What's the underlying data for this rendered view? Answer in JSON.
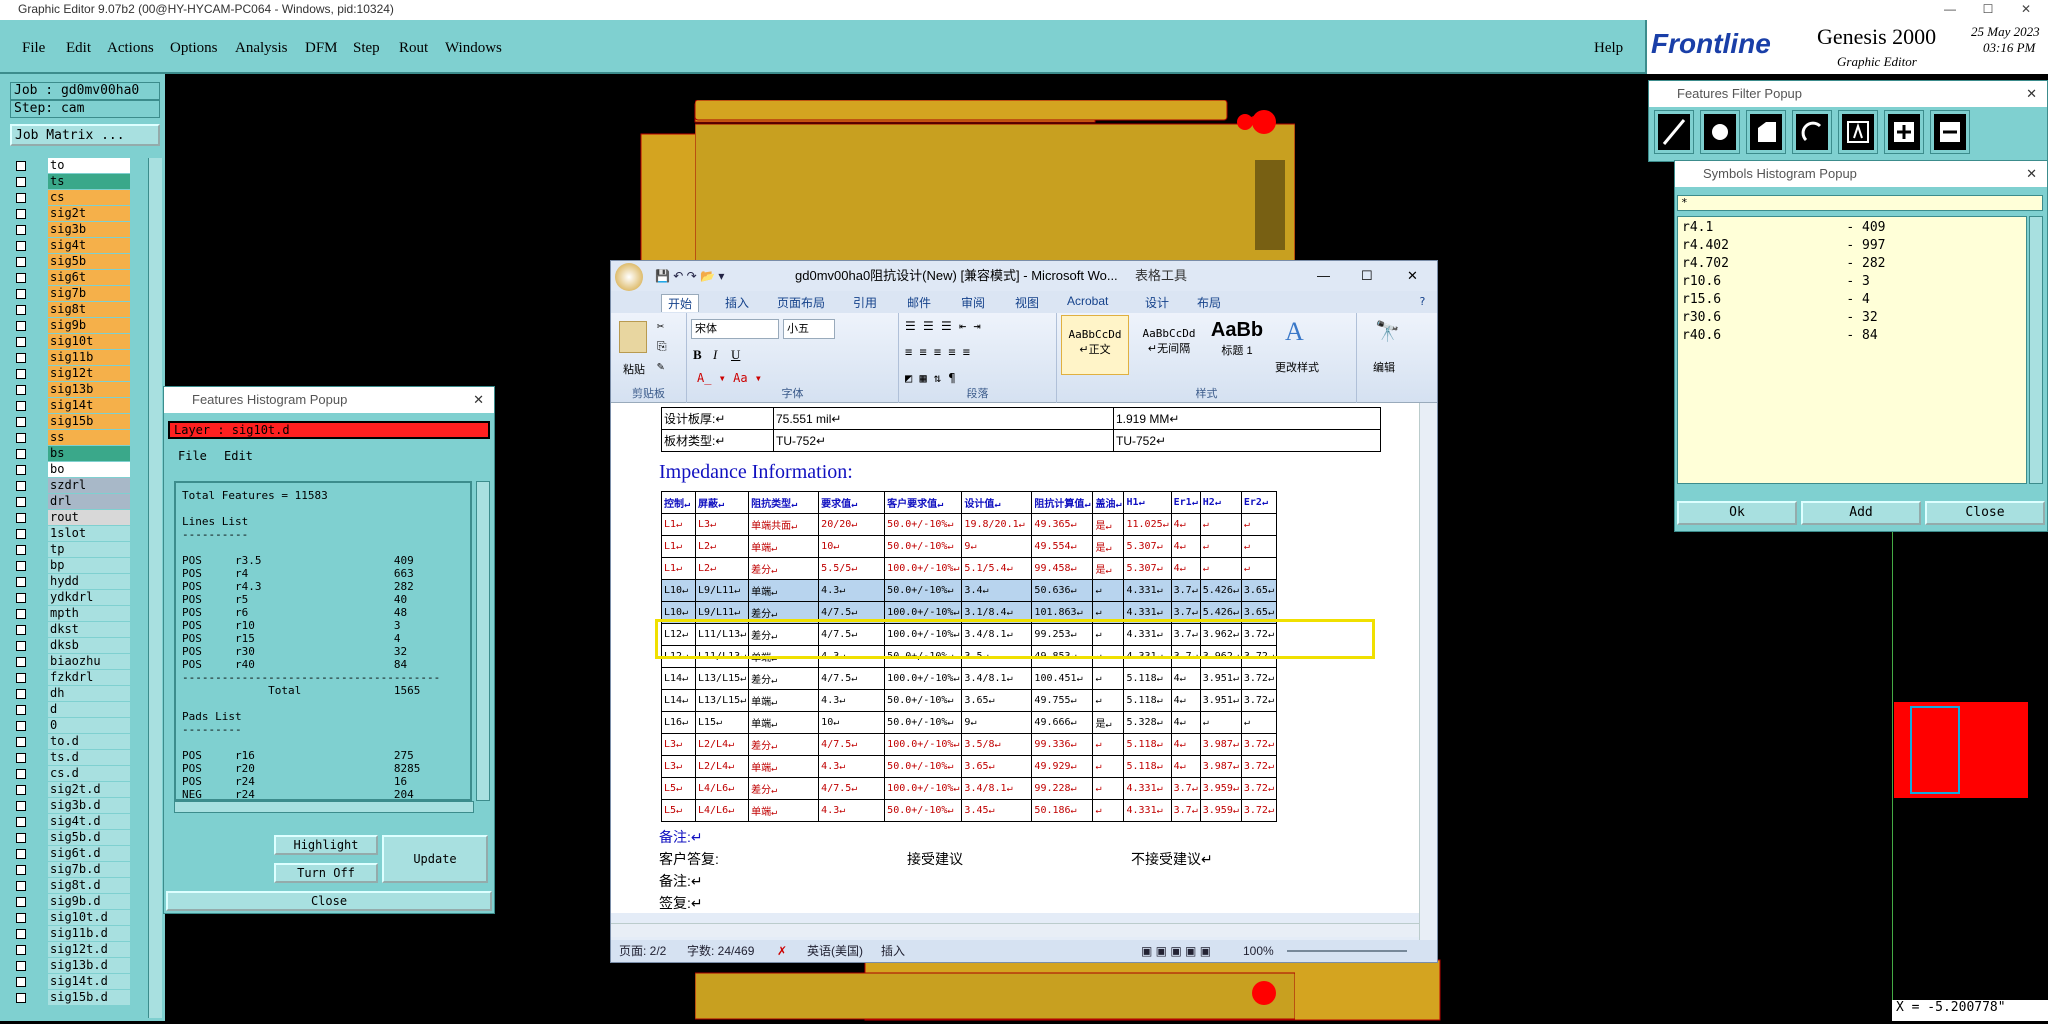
{
  "app": {
    "title": "Graphic Editor 9.07b2 (00@HY-HYCAM-PC064 - Windows, pid:10324)",
    "menu": [
      "File",
      "Edit",
      "Actions",
      "Options",
      "Analysis",
      "DFM",
      "Step",
      "Rout",
      "Windows"
    ],
    "help": "Help",
    "brand_name": "Frontline",
    "product": "Genesis 2000",
    "product_sub": "Graphic Editor",
    "date": "25 May 2023",
    "time": "03:16 PM"
  },
  "left_panel": {
    "job": "Job : gd0mv00ha0",
    "step": "Step: cam",
    "job_matrix": "Job Matrix ...",
    "layers": [
      {
        "name": "to",
        "color": "#ffffff"
      },
      {
        "name": "ts",
        "color": "#3aa88a"
      },
      {
        "name": "cs",
        "color": "#f5b04a"
      },
      {
        "name": "sig2t",
        "color": "#f5b04a"
      },
      {
        "name": "sig3b",
        "color": "#f5b04a"
      },
      {
        "name": "sig4t",
        "color": "#f5b04a"
      },
      {
        "name": "sig5b",
        "color": "#f5b04a"
      },
      {
        "name": "sig6t",
        "color": "#f5b04a"
      },
      {
        "name": "sig7b",
        "color": "#f5b04a"
      },
      {
        "name": "sig8t",
        "color": "#f5b04a"
      },
      {
        "name": "sig9b",
        "color": "#f5b04a"
      },
      {
        "name": "sig10t",
        "color": "#f5b04a"
      },
      {
        "name": "sig11b",
        "color": "#f5b04a"
      },
      {
        "name": "sig12t",
        "color": "#f5b04a"
      },
      {
        "name": "sig13b",
        "color": "#f5b04a"
      },
      {
        "name": "sig14t",
        "color": "#f5b04a"
      },
      {
        "name": "sig15b",
        "color": "#f5b04a"
      },
      {
        "name": "ss",
        "color": "#f5b04a"
      },
      {
        "name": "bs",
        "color": "#3aa88a"
      },
      {
        "name": "bo",
        "color": "#ffffff"
      },
      {
        "name": "szdrl",
        "color": "#a8b8c8"
      },
      {
        "name": "drl",
        "color": "#a8b8c8"
      },
      {
        "name": "rout",
        "color": "#d8d8d8"
      },
      {
        "name": "1slot",
        "color": "#a8e0e0"
      },
      {
        "name": "tp",
        "color": "#a8e0e0"
      },
      {
        "name": "bp",
        "color": "#a8e0e0"
      },
      {
        "name": "hydd",
        "color": "#a8e0e0"
      },
      {
        "name": "ydkdrl",
        "color": "#a8e0e0"
      },
      {
        "name": "mpth",
        "color": "#a8e0e0"
      },
      {
        "name": "dkst",
        "color": "#a8e0e0"
      },
      {
        "name": "dksb",
        "color": "#a8e0e0"
      },
      {
        "name": "biaozhu",
        "color": "#a8e0e0"
      },
      {
        "name": "fzkdrl",
        "color": "#a8e0e0"
      },
      {
        "name": "dh",
        "color": "#a8e0e0"
      },
      {
        "name": "d",
        "color": "#a8e0e0"
      },
      {
        "name": "0",
        "color": "#a8e0e0"
      },
      {
        "name": "to.d",
        "color": "#a8e0e0"
      },
      {
        "name": "ts.d",
        "color": "#a8e0e0"
      },
      {
        "name": "cs.d",
        "color": "#a8e0e0"
      },
      {
        "name": "sig2t.d",
        "color": "#a8e0e0"
      },
      {
        "name": "sig3b.d",
        "color": "#a8e0e0"
      },
      {
        "name": "sig4t.d",
        "color": "#a8e0e0"
      },
      {
        "name": "sig5b.d",
        "color": "#a8e0e0"
      },
      {
        "name": "sig6t.d",
        "color": "#a8e0e0"
      },
      {
        "name": "sig7b.d",
        "color": "#a8e0e0"
      },
      {
        "name": "sig8t.d",
        "color": "#a8e0e0"
      },
      {
        "name": "sig9b.d",
        "color": "#a8e0e0"
      },
      {
        "name": "sig10t.d",
        "color": "#a8e0e0"
      },
      {
        "name": "sig11b.d",
        "color": "#a8e0e0"
      },
      {
        "name": "sig12t.d",
        "color": "#a8e0e0"
      },
      {
        "name": "sig13b.d",
        "color": "#a8e0e0"
      },
      {
        "name": "sig14t.d",
        "color": "#a8e0e0"
      },
      {
        "name": "sig15b.d",
        "color": "#a8e0e0"
      }
    ]
  },
  "features_histogram": {
    "title": "Features Histogram Popup",
    "layer": "Layer : sig10t.d",
    "menu": [
      "File",
      "Edit"
    ],
    "text": "Total Features = 11583\n\nLines List\n----------\n\nPOS     r3.5                    409\nPOS     r4                      663\nPOS     r4.3                    282\nPOS     r5                      40\nPOS     r6                      48\nPOS     r10                     3\nPOS     r15                     4\nPOS     r30                     32\nPOS     r40                     84\n---------------------------------------\n             Total              1565\n\nPads List\n---------\n\nPOS     r16                     275\nPOS     r20                     8285\nPOS     r24                     16\nNEG     r24                     204",
    "highlight": "Highlight",
    "turn_off": "Turn Off",
    "update": "Update",
    "close": "Close"
  },
  "word": {
    "title": "gd0mv00ha0阻抗设计(New) [兼容模式] - Microsoft Wo...",
    "context_tab": "表格工具",
    "tabs": [
      "开始",
      "插入",
      "页面布局",
      "引用",
      "邮件",
      "审阅",
      "视图",
      "Acrobat",
      "设计",
      "布局"
    ],
    "font_name": "宋体",
    "font_size": "小五",
    "groups": [
      "剪贴板",
      "字体",
      "段落",
      "样式"
    ],
    "paste": "粘贴",
    "styles": [
      {
        "preview": "AaBbCcDd",
        "name": "↵正文"
      },
      {
        "preview": "AaBbCcDd",
        "name": "↵无间隔"
      },
      {
        "preview": "AaBb",
        "name": "标题 1"
      }
    ],
    "change_style": "更改样式",
    "edit": "编辑",
    "board_rows": [
      [
        "设计板厚:↵",
        "75.551 mil↵",
        "1.919 MM↵"
      ],
      [
        "板材类型:↵",
        "TU-752↵",
        "TU-752↵"
      ]
    ],
    "heading": "Impedance Information:",
    "columns": [
      "控制↵",
      "屏蔽↵",
      "阻抗类型↵",
      "要求值↵",
      "客户要求值↵",
      "设计值↵",
      "阻抗计算值↵",
      "盖油↵",
      "H1↵",
      "Er1↵",
      "H2↵",
      "Er2↵"
    ],
    "rows": [
      {
        "style": "red",
        "cells": [
          "L1↵",
          "L3↵",
          "单端共面↵",
          "20/20↵",
          "50.0+/-10%↵",
          "19.8/20.1↵",
          "49.365↵",
          "是↵",
          "11.025↵",
          "4↵",
          "↵",
          "↵"
        ]
      },
      {
        "style": "red",
        "cells": [
          "L1↵",
          "L2↵",
          "单端↵",
          "10↵",
          "50.0+/-10%↵",
          "9↵",
          "49.554↵",
          "是↵",
          "5.307↵",
          "4↵",
          "↵",
          "↵"
        ]
      },
      {
        "style": "red",
        "cells": [
          "L1↵",
          "L2↵",
          "差分↵",
          "5.5/5↵",
          "100.0+/-10%↵",
          "5.1/5.4↵",
          "99.458↵",
          "是↵",
          "5.307↵",
          "4↵",
          "↵",
          "↵"
        ]
      },
      {
        "style": "sel",
        "cells": [
          "L10↵",
          "L9/L11↵",
          "单端↵",
          "4.3↵",
          "50.0+/-10%↵",
          "3.4↵",
          "50.636↵",
          "↵",
          "4.331↵",
          "3.7↵",
          "5.426↵",
          "3.65↵"
        ]
      },
      {
        "style": "sel",
        "cells": [
          "L10↵",
          "L9/L11↵",
          "差分↵",
          "4/7.5↵",
          "100.0+/-10%↵",
          "3.1/8.4↵",
          "101.863↵",
          "↵",
          "4.331↵",
          "3.7↵",
          "5.426↵",
          "3.65↵"
        ]
      },
      {
        "style": "plain",
        "cells": [
          "L12↵",
          "L11/L13↵",
          "差分↵",
          "4/7.5↵",
          "100.0+/-10%↵",
          "3.4/8.1↵",
          "99.253↵",
          "↵",
          "4.331↵",
          "3.7↵",
          "3.962↵",
          "3.72↵"
        ]
      },
      {
        "style": "plain",
        "cells": [
          "L12↵",
          "L11/L13↵",
          "单端↵",
          "4.3↵",
          "50.0+/-10%↵",
          "3.5↵",
          "49.853↵",
          "↵",
          "4.331↵",
          "3.7↵",
          "3.962↵",
          "3.72↵"
        ]
      },
      {
        "style": "plain",
        "cells": [
          "L14↵",
          "L13/L15↵",
          "差分↵",
          "4/7.5↵",
          "100.0+/-10%↵",
          "3.4/8.1↵",
          "100.451↵",
          "↵",
          "5.118↵",
          "4↵",
          "3.951↵",
          "3.72↵"
        ]
      },
      {
        "style": "plain",
        "cells": [
          "L14↵",
          "L13/L15↵",
          "单端↵",
          "4.3↵",
          "50.0+/-10%↵",
          "3.65↵",
          "49.755↵",
          "↵",
          "5.118↵",
          "4↵",
          "3.951↵",
          "3.72↵"
        ]
      },
      {
        "style": "plain",
        "cells": [
          "L16↵",
          "L15↵",
          "单端↵",
          "10↵",
          "50.0+/-10%↵",
          "9↵",
          "49.666↵",
          "是↵",
          "5.328↵",
          "4↵",
          "↵",
          "↵"
        ]
      },
      {
        "style": "red",
        "cells": [
          "L3↵",
          "L2/L4↵",
          "差分↵",
          "4/7.5↵",
          "100.0+/-10%↵",
          "3.5/8↵",
          "99.336↵",
          "↵",
          "5.118↵",
          "4↵",
          "3.987↵",
          "3.72↵"
        ]
      },
      {
        "style": "red",
        "cells": [
          "L3↵",
          "L2/L4↵",
          "单端↵",
          "4.3↵",
          "50.0+/-10%↵",
          "3.65↵",
          "49.929↵",
          "↵",
          "5.118↵",
          "4↵",
          "3.987↵",
          "3.72↵"
        ]
      },
      {
        "style": "red",
        "cells": [
          "L5↵",
          "L4/L6↵",
          "差分↵",
          "4/7.5↵",
          "100.0+/-10%↵",
          "3.4/8.1↵",
          "99.228↵",
          "↵",
          "4.331↵",
          "3.7↵",
          "3.959↵",
          "3.72↵"
        ]
      },
      {
        "style": "red",
        "cells": [
          "L5↵",
          "L4/L6↵",
          "单端↵",
          "4.3↵",
          "50.0+/-10%↵",
          "3.45↵",
          "50.186↵",
          "↵",
          "4.331↵",
          "3.7↵",
          "3.959↵",
          "3.72↵"
        ]
      }
    ],
    "remark1": "备注:↵",
    "customer_reply": "客户答复:",
    "accept": "接受建议",
    "reject": "不接受建议↵",
    "remark2": "备注:↵",
    "sign": "签复:↵",
    "status": {
      "page": "页面: 2/2",
      "words": "字数: 24/469",
      "lang": "英语(美国)",
      "mode": "插入",
      "zoom": "100%"
    }
  },
  "features_filter": {
    "title": "Features Filter Popup"
  },
  "symbols_histogram": {
    "title": "Symbols Histogram Popup",
    "filter": "*",
    "list": "r4.1                 - 409\nr4.402               - 997\nr4.702               - 282\nr10.6                - 3\nr15.6                - 4\nr30.6                - 32\nr40.6                - 84",
    "ok": "Ok",
    "add": "Add",
    "close": "Close"
  },
  "coord": "X = -5.200778\"",
  "colors": {
    "panel": "#7fd0d0",
    "accent_red": "#ff0000",
    "pcb_gold": "#d4a420",
    "highlight_box": "#f0e000"
  }
}
